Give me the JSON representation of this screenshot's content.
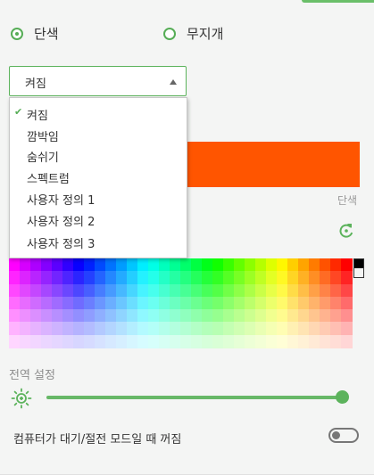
{
  "color_mode": {
    "options": [
      {
        "label": "단색",
        "checked": true
      },
      {
        "label": "무지개",
        "checked": false
      }
    ]
  },
  "effect_select": {
    "value": "켜짐",
    "options": [
      "켜짐",
      "깜박임",
      "숨쉬기",
      "스펙트럼",
      "사용자 정의 1",
      "사용자 정의 2",
      "사용자 정의 3"
    ],
    "selected_index": 0
  },
  "preview": {
    "color": "#ff5500",
    "mode_label": "단색"
  },
  "palette": {
    "rows": 7
  },
  "global": {
    "title": "전역 설정",
    "brightness_fraction": 1.0,
    "sleep_label": "컴퓨터가 대기/절전 모드일 때 꺼짐",
    "sleep_enabled": false
  },
  "colors": {
    "accent": "#5cb35c",
    "accent_light": "#6abf69"
  },
  "icons": {
    "brightness": "sun-icon",
    "reset": "refresh-icon",
    "dropdown_caret": "caret-up-icon",
    "selected": "checkmark-icon"
  }
}
